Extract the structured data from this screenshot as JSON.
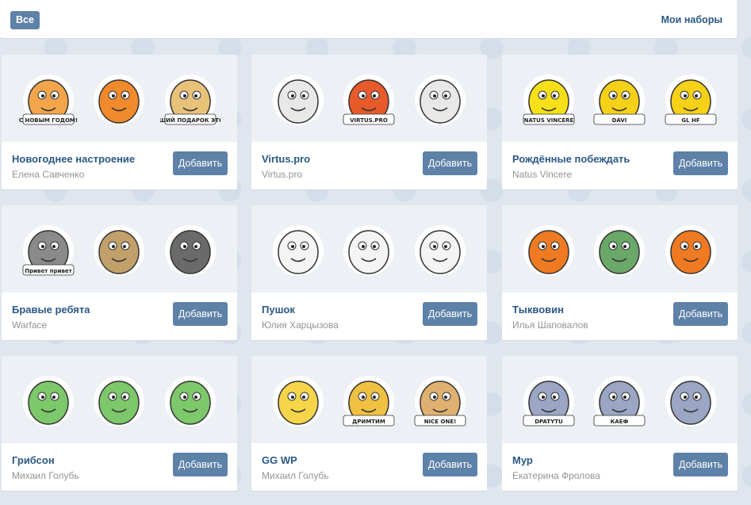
{
  "header": {
    "all_label": "Все",
    "my_sets_label": "Мои наборы"
  },
  "cards": [
    {
      "title": "Новогоднее настроение",
      "author": "Елена Савченко",
      "button": "Добавить",
      "stickers": [
        {
          "icon": "hamster-new-year-icon",
          "caption": "С НОВЫМ ГОДОМ!",
          "color": "#f2a54a"
        },
        {
          "icon": "hamster-fruits-icon",
          "caption": "",
          "color": "#f08a2c"
        },
        {
          "icon": "hamster-gift-card-icon",
          "caption": "ЛУЧШИЙ ПОДАРОК ЭТО ТЫ",
          "color": "#e9c27a"
        }
      ]
    },
    {
      "title": "Virtus.pro",
      "author": "Virtus.pro",
      "button": "Добавить",
      "stickers": [
        {
          "icon": "bear-flex-icon",
          "caption": "",
          "color": "#e8e8e8"
        },
        {
          "icon": "bear-scarf-icon",
          "caption": "VIRTUS.PRO",
          "color": "#e85a2a"
        },
        {
          "icon": "bear-facepalm-icon",
          "caption": "",
          "color": "#e8e8e8"
        }
      ]
    },
    {
      "title": "Рождённые побеждать",
      "author": "Natus Vincere",
      "button": "Добавить",
      "stickers": [
        {
          "icon": "navi-logo-icon",
          "caption": "NATUS VINCERE",
          "color": "#f7e017"
        },
        {
          "icon": "foam-finger-icon",
          "caption": "DAVI",
          "color": "#f7d117"
        },
        {
          "icon": "victory-hand-icon",
          "caption": "GL HF",
          "color": "#f7d117"
        }
      ]
    },
    {
      "title": "Бравые ребята",
      "author": "Warface",
      "button": "Добавить",
      "stickers": [
        {
          "icon": "soldier-hello-icon",
          "caption": "Привет привет",
          "color": "#8a8a8a"
        },
        {
          "icon": "soldier-rock-icon",
          "caption": "",
          "color": "#c2a06a"
        },
        {
          "icon": "soldier-rifle-icon",
          "caption": "",
          "color": "#6a6a6a"
        }
      ]
    },
    {
      "title": "Пушок",
      "author": "Юлия Харцызова",
      "button": "Добавить",
      "stickers": [
        {
          "icon": "fluffy-cat-running-icon",
          "caption": "",
          "color": "#f4f4f4"
        },
        {
          "icon": "fluffy-cat-love-icon",
          "caption": "",
          "color": "#f4f4f4"
        },
        {
          "icon": "fluffy-cat-sitting-icon",
          "caption": "",
          "color": "#f4f4f4"
        }
      ]
    },
    {
      "title": "Тыквовин",
      "author": "Илья Шаповалов",
      "button": "Добавить",
      "stickers": [
        {
          "icon": "pumpkin-dracula-icon",
          "caption": "",
          "color": "#f07a22"
        },
        {
          "icon": "pumpkin-frankenstein-icon",
          "caption": "",
          "color": "#6aa86a"
        },
        {
          "icon": "pumpkin-witch-icon",
          "caption": "",
          "color": "#f07a22"
        }
      ]
    },
    {
      "title": "Грибсон",
      "author": "Михаил Голубь",
      "button": "Добавить",
      "stickers": [
        {
          "icon": "mushroom-worried-icon",
          "caption": "",
          "color": "#7cc86a"
        },
        {
          "icon": "mushroom-cheer-icon",
          "caption": "",
          "color": "#7cc86a"
        },
        {
          "icon": "mushroom-relaxed-icon",
          "caption": "",
          "color": "#7cc86a"
        }
      ]
    },
    {
      "title": "GG WP",
      "author": "Михаил Голубь",
      "button": "Добавить",
      "stickers": [
        {
          "icon": "duck-dancing-icon",
          "caption": "",
          "color": "#f7d54a"
        },
        {
          "icon": "duck-dreamteam-icon",
          "caption": "ДРИМТИМ",
          "color": "#f0c040"
        },
        {
          "icon": "dog-nice-one-icon",
          "caption": "NICE ONE!",
          "color": "#e0b070"
        }
      ]
    },
    {
      "title": "Мур",
      "author": "Екатерина Фролова",
      "button": "Добавить",
      "stickers": [
        {
          "icon": "bird-hello-icon",
          "caption": "DPATYTU",
          "color": "#9aa6c4"
        },
        {
          "icon": "bird-kaef-icon",
          "caption": "КАЕФ",
          "color": "#9aa6c4"
        },
        {
          "icon": "bird-flying-icon",
          "caption": "",
          "color": "#9aa6c4"
        }
      ]
    }
  ]
}
